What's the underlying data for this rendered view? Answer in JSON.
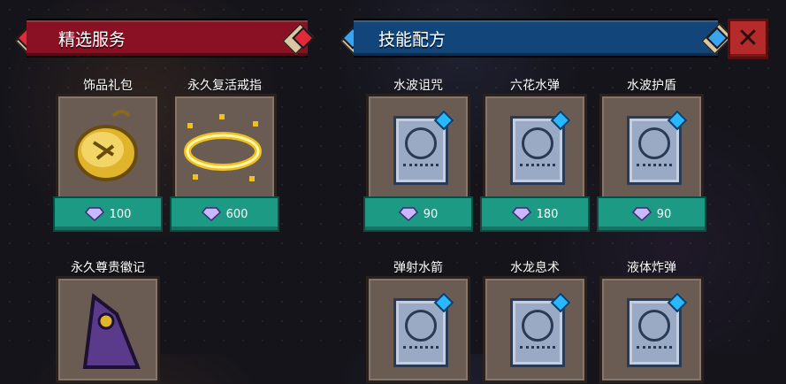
{
  "header": {
    "left_title": "精选服务",
    "right_title": "技能配方",
    "close_label": "✕"
  },
  "left_items": [
    {
      "name": "饰品礼包",
      "price": "100",
      "icon": "golden-pocket-watch-icon"
    },
    {
      "name": "永久复活戒指",
      "price": "600",
      "icon": "golden-halo-ring-icon"
    },
    {
      "name": "永久尊贵徽记",
      "price": "",
      "icon": "purple-wizard-hat-icon"
    }
  ],
  "right_items": [
    {
      "name": "水波诅咒",
      "price": "90",
      "icon": "skill-scroll-icon"
    },
    {
      "name": "六花水弹",
      "price": "180",
      "icon": "skill-scroll-icon"
    },
    {
      "name": "水波护盾",
      "price": "90",
      "icon": "skill-scroll-icon"
    },
    {
      "name": "弹射水箭",
      "price": "",
      "icon": "skill-scroll-icon"
    },
    {
      "name": "水龙息术",
      "price": "",
      "icon": "skill-scroll-icon"
    },
    {
      "name": "液体炸弹",
      "price": "",
      "icon": "skill-scroll-icon"
    }
  ],
  "colors": {
    "left_banner": "#8a1023",
    "right_banner": "#12457a",
    "price_bar": "#1c9a84",
    "card": "#6b5c53"
  }
}
